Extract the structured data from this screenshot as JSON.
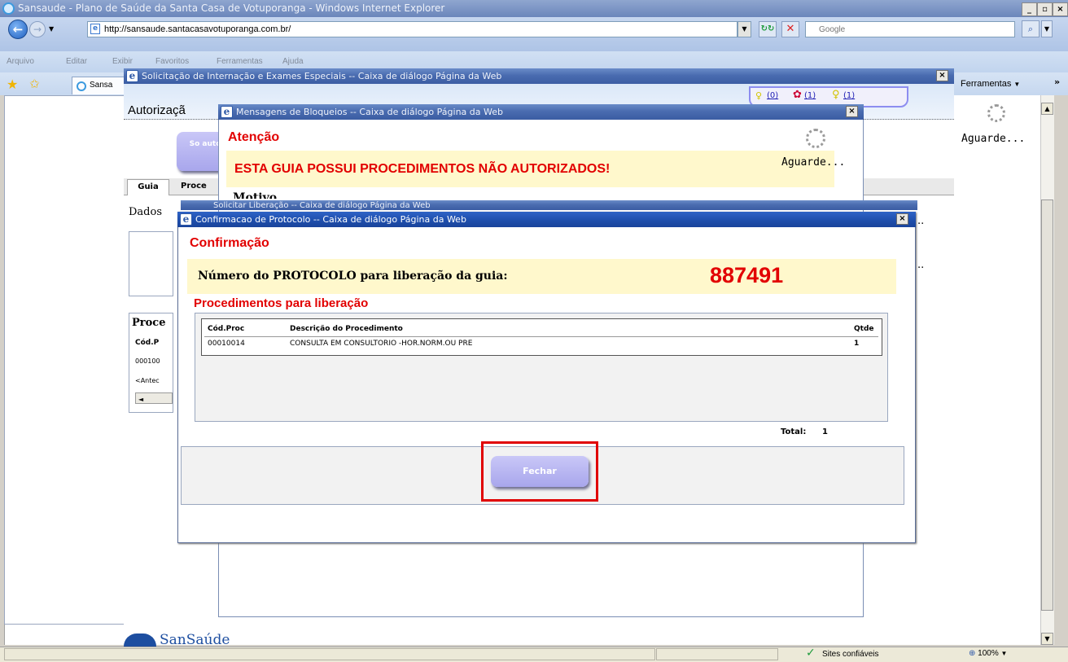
{
  "browser": {
    "title": "Sansaude - Plano de Saúde da Santa Casa de Votuporanga - Windows Internet Explorer",
    "url": "http://sansaude.santacasavotuporanga.com.br/",
    "search_placeholder": "Google",
    "menu": [
      "Arquivo",
      "Editar",
      "Exibir",
      "Favoritos",
      "Ferramentas",
      "Ajuda"
    ],
    "tab_label": "Sansa",
    "tools_label": "Ferramentas",
    "status_zone": "Sites confiáveis",
    "zoom": "100%"
  },
  "right_panel": {
    "loading_label": "Aguarde..."
  },
  "dialog1": {
    "title": "Solicitação de Internação e Exames Especiais -- Caixa de diálogo Página da Web",
    "heading": "Autorizaçã",
    "counters": [
      "(0)",
      "(1)",
      "(1)"
    ],
    "button_label": "So auto",
    "tabs": [
      "Guia",
      "Proce"
    ],
    "section_dados": "Dados",
    "section_proc": "Proce",
    "grid_head": "Cód.P",
    "grid_row": "000100",
    "pager": "<Antec"
  },
  "dialog2": {
    "title": "Mensagens de Bloqueios -- Caixa de diálogo Página da Web",
    "heading": "Atenção",
    "message": "ESTA GUIA POSSUI PROCEDIMENTOS NÃO AUTORIZADOS!",
    "loading_label": "Aguarde...",
    "sub_heading": "Motivo",
    "behind_title": "Solicitar Liberação -- Caixa de diálogo Página da Web"
  },
  "dialog3": {
    "title": "Confirmacao de Protocolo -- Caixa de diálogo Página da Web",
    "heading": "Confirmação",
    "protocol_label": "Número do PROTOCOLO para liberação da guia:",
    "protocol_number": "887491",
    "proc_heading": "Procedimentos para liberação",
    "table": {
      "headers": [
        "Cód.Proc",
        "Descrição do Procedimento",
        "Qtde"
      ],
      "rows": [
        [
          "00010014",
          "CONSULTA EM CONSULTORIO -HOR.NORM.OU PRE",
          "1"
        ]
      ]
    },
    "total_label": "Total:",
    "total_value": "1",
    "close_label": "Fechar"
  },
  "footer_logo": "SanSaúde"
}
